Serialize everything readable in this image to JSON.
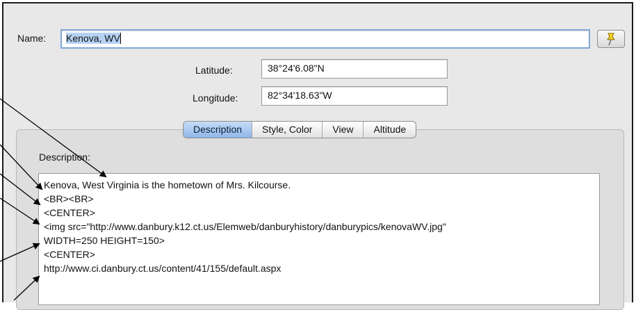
{
  "name": {
    "label": "Name:",
    "value": "Kenova, WV"
  },
  "latitude": {
    "label": "Latitude:",
    "value": "38°24'6.08\"N"
  },
  "longitude": {
    "label": "Longitude:",
    "value": "82°34'18.63\"W"
  },
  "tabs": [
    {
      "label": "Description",
      "active": true
    },
    {
      "label": "Style, Color",
      "active": false
    },
    {
      "label": "View",
      "active": false
    },
    {
      "label": "Altitude",
      "active": false
    }
  ],
  "description": {
    "label": "Description:",
    "lines": [
      "Kenova, West Virginia is the hometown of Mrs. Kilcourse.",
      "<BR><BR>",
      "<CENTER>",
      "<img src=\"http://www.danbury.k12.ct.us/Elemweb/danburyhistory/danburypics/kenovaWV.jpg\"",
      "WIDTH=250 HEIGHT=150>",
      "<CENTER>",
      "http://www.ci.danbury.ct.us/content/41/155/default.aspx"
    ]
  },
  "icons": {
    "pin_button": "pushpin-icon"
  },
  "colors": {
    "accent": "#8fb6e8",
    "pin": "#f2d321"
  }
}
